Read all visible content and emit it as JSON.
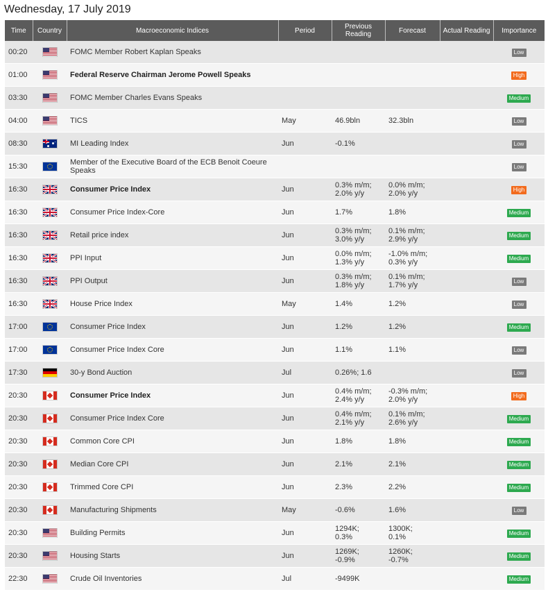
{
  "date_title": "Wednesday, 17 July 2019",
  "headers": {
    "time": "Time",
    "country": "Country",
    "event": "Macroeconomic Indices",
    "period": "Period",
    "previous": "Previous Reading",
    "forecast": "Forecast",
    "actual": "Actual Reading",
    "importance": "Importance"
  },
  "importance_colors": {
    "Low": "#7a7a7a",
    "Medium": "#2da94f",
    "High": "#f26b1d"
  },
  "events": [
    {
      "time": "00:20",
      "flag": "us",
      "flag_icon": "us-flag-icon",
      "event": "FOMC Member Robert Kaplan Speaks",
      "bold": false,
      "period": "",
      "previous": [],
      "forecast": [],
      "actual": "",
      "importance": "Low"
    },
    {
      "time": "01:00",
      "flag": "us",
      "flag_icon": "us-flag-icon",
      "event": "Federal Reserve Chairman Jerome Powell Speaks",
      "bold": true,
      "period": "",
      "previous": [],
      "forecast": [],
      "actual": "",
      "importance": "High"
    },
    {
      "time": "03:30",
      "flag": "us",
      "flag_icon": "us-flag-icon",
      "event": "FOMC Member Charles Evans Speaks",
      "bold": false,
      "period": "",
      "previous": [],
      "forecast": [],
      "actual": "",
      "importance": "Medium"
    },
    {
      "time": "04:00",
      "flag": "us",
      "flag_icon": "us-flag-icon",
      "event": "TICS",
      "bold": false,
      "period": "May",
      "previous": [
        "46.9bln"
      ],
      "forecast": [
        "32.3bln"
      ],
      "actual": "",
      "importance": "Low"
    },
    {
      "time": "08:30",
      "flag": "au",
      "flag_icon": "australia-flag-icon",
      "event": "MI Leading Index",
      "bold": false,
      "period": "Jun",
      "previous": [
        "-0.1%"
      ],
      "forecast": [],
      "actual": "",
      "importance": "Low"
    },
    {
      "time": "15:30",
      "flag": "eu",
      "flag_icon": "eu-flag-icon",
      "event": "Member of the Executive Board of the ECB Benoit Coeure Speaks",
      "bold": false,
      "period": "",
      "previous": [],
      "forecast": [],
      "actual": "",
      "importance": "Low"
    },
    {
      "time": "16:30",
      "flag": "gb",
      "flag_icon": "uk-flag-icon",
      "event": "Consumer Price Index",
      "bold": true,
      "period": "Jun",
      "previous": [
        "0.3% m/m;",
        "2.0% y/y"
      ],
      "forecast": [
        "0.0% m/m;",
        "2.0% y/y"
      ],
      "actual": "",
      "importance": "High"
    },
    {
      "time": "16:30",
      "flag": "gb",
      "flag_icon": "uk-flag-icon",
      "event": "Consumer Price Index-Core",
      "bold": false,
      "period": "Jun",
      "previous": [
        "1.7%"
      ],
      "forecast": [
        "1.8%"
      ],
      "actual": "",
      "importance": "Medium"
    },
    {
      "time": "16:30",
      "flag": "gb",
      "flag_icon": "uk-flag-icon",
      "event": "Retail price index",
      "bold": false,
      "period": "Jun",
      "previous": [
        "0.3% m/m;",
        "3.0% y/y"
      ],
      "forecast": [
        "0.1% m/m;",
        "2.9% y/y"
      ],
      "actual": "",
      "importance": "Medium"
    },
    {
      "time": "16:30",
      "flag": "gb",
      "flag_icon": "uk-flag-icon",
      "event": "PPI Input",
      "bold": false,
      "period": "Jun",
      "previous": [
        "0.0% m/m;",
        "1.3% y/y"
      ],
      "forecast": [
        "-1.0% m/m;",
        "0.3% y/y"
      ],
      "actual": "",
      "importance": "Medium"
    },
    {
      "time": "16:30",
      "flag": "gb",
      "flag_icon": "uk-flag-icon",
      "event": "PPI Output",
      "bold": false,
      "period": "Jun",
      "previous": [
        "0.3% m/m;",
        "1.8% y/y"
      ],
      "forecast": [
        "0.1% m/m;",
        "1.7% y/y"
      ],
      "actual": "",
      "importance": "Low"
    },
    {
      "time": "16:30",
      "flag": "gb",
      "flag_icon": "uk-flag-icon",
      "event": "House Price Index",
      "bold": false,
      "period": "May",
      "previous": [
        "1.4%"
      ],
      "forecast": [
        "1.2%"
      ],
      "actual": "",
      "importance": "Low"
    },
    {
      "time": "17:00",
      "flag": "eu",
      "flag_icon": "eu-flag-icon",
      "event": "Consumer Price Index",
      "bold": false,
      "period": "Jun",
      "previous": [
        "1.2%"
      ],
      "forecast": [
        "1.2%"
      ],
      "actual": "",
      "importance": "Medium"
    },
    {
      "time": "17:00",
      "flag": "eu",
      "flag_icon": "eu-flag-icon",
      "event": "Consumer Price Index Core",
      "bold": false,
      "period": "Jun",
      "previous": [
        "1.1%"
      ],
      "forecast": [
        "1.1%"
      ],
      "actual": "",
      "importance": "Low"
    },
    {
      "time": "17:30",
      "flag": "de",
      "flag_icon": "germany-flag-icon",
      "event": "30-y Bond Auction",
      "bold": false,
      "period": "Jul",
      "previous": [
        "0.26%; 1.6"
      ],
      "forecast": [],
      "actual": "",
      "importance": "Low"
    },
    {
      "time": "20:30",
      "flag": "ca",
      "flag_icon": "canada-flag-icon",
      "event": "Consumer Price Index",
      "bold": true,
      "period": "Jun",
      "previous": [
        "0.4% m/m;",
        "2.4% y/y"
      ],
      "forecast": [
        "-0.3% m/m;",
        "2.0% y/y"
      ],
      "actual": "",
      "importance": "High"
    },
    {
      "time": "20:30",
      "flag": "ca",
      "flag_icon": "canada-flag-icon",
      "event": "Consumer Price Index Core",
      "bold": false,
      "period": "Jun",
      "previous": [
        "0.4% m/m;",
        "2.1% y/y"
      ],
      "forecast": [
        "0.1% m/m;",
        "2.6% y/y"
      ],
      "actual": "",
      "importance": "Medium"
    },
    {
      "time": "20:30",
      "flag": "ca",
      "flag_icon": "canada-flag-icon",
      "event": "Common Core CPI",
      "bold": false,
      "period": "Jun",
      "previous": [
        "1.8%"
      ],
      "forecast": [
        "1.8%"
      ],
      "actual": "",
      "importance": "Medium"
    },
    {
      "time": "20:30",
      "flag": "ca",
      "flag_icon": "canada-flag-icon",
      "event": "Median Core CPI",
      "bold": false,
      "period": "Jun",
      "previous": [
        "2.1%"
      ],
      "forecast": [
        "2.1%"
      ],
      "actual": "",
      "importance": "Medium"
    },
    {
      "time": "20:30",
      "flag": "ca",
      "flag_icon": "canada-flag-icon",
      "event": "Trimmed Core CPI",
      "bold": false,
      "period": "Jun",
      "previous": [
        "2.3%"
      ],
      "forecast": [
        "2.2%"
      ],
      "actual": "",
      "importance": "Medium"
    },
    {
      "time": "20:30",
      "flag": "ca",
      "flag_icon": "canada-flag-icon",
      "event": "Manufacturing Shipments",
      "bold": false,
      "period": "May",
      "previous": [
        "-0.6%"
      ],
      "forecast": [
        "1.6%"
      ],
      "actual": "",
      "importance": "Low"
    },
    {
      "time": "20:30",
      "flag": "us",
      "flag_icon": "us-flag-icon",
      "event": "Building Permits",
      "bold": false,
      "period": "Jun",
      "previous": [
        "1294K;",
        "0.3%"
      ],
      "forecast": [
        "1300K;",
        "0.1%"
      ],
      "actual": "",
      "importance": "Medium"
    },
    {
      "time": "20:30",
      "flag": "us",
      "flag_icon": "us-flag-icon",
      "event": "Housing Starts",
      "bold": false,
      "period": "Jun",
      "previous": [
        "1269K;",
        "-0.9%"
      ],
      "forecast": [
        "1260K;",
        "-0.7%"
      ],
      "actual": "",
      "importance": "Medium"
    },
    {
      "time": "22:30",
      "flag": "us",
      "flag_icon": "us-flag-icon",
      "event": "Crude Oil Inventories",
      "bold": false,
      "period": "Jul",
      "previous": [
        "-9499K"
      ],
      "forecast": [],
      "actual": "",
      "importance": "Medium"
    }
  ]
}
